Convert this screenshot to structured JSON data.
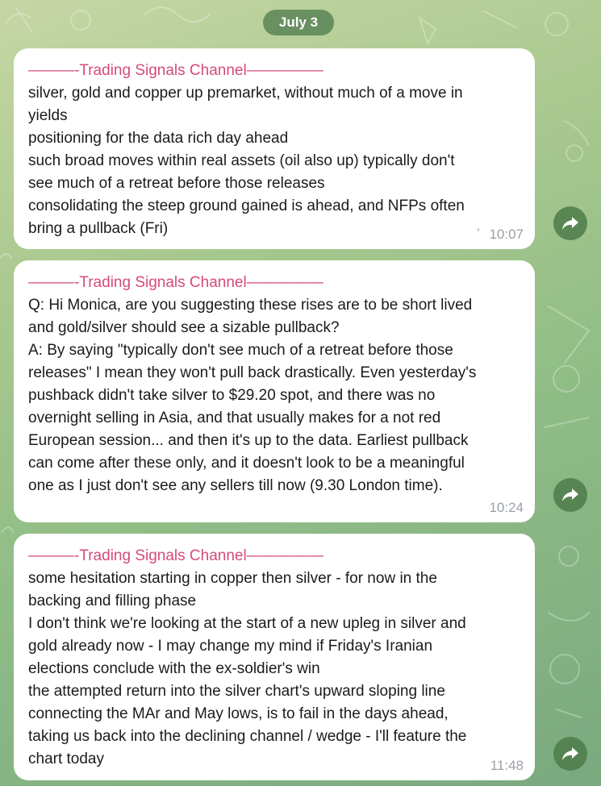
{
  "date_label": "July 3",
  "messages": [
    {
      "channel": "———-Trading Signals Channel—————",
      "lines": [
        "silver, gold and copper up premarket, without much of a move in",
        "yields",
        "positioning for the data rich day ahead",
        "such broad moves within real assets (oil also up) typically don't",
        "see much of a retreat before those releases",
        "consolidating the steep ground gained is ahead, and NFPs often",
        "bring a pullback (Fri)"
      ],
      "time": "10:07"
    },
    {
      "channel": "———-Trading Signals Channel—————",
      "lines": [
        "Q: Hi Monica, are you suggesting these rises are to be short lived",
        "and gold/silver should see a sizable pullback?",
        "A: By saying \"typically don't see much of a retreat before those",
        "releases\" I mean they won't pull back drastically. Even yesterday's",
        "pushback didn't take silver to $29.20 spot, and there was no",
        "overnight selling in Asia, and that usually makes for a not red",
        "European session... and then it's up to the data. Earliest pullback",
        "can come after these only, and it doesn't look to be a meaningful",
        "one as I just don't see any sellers till now (9.30 London time)."
      ],
      "time": "10:24"
    },
    {
      "channel": "———-Trading Signals Channel—————",
      "lines": [
        "some hesitation starting in copper then silver - for now in the",
        "backing and filling phase",
        "I don't think we're looking at the start of a new upleg in silver and",
        "gold already now - I may change my mind if Friday's Iranian",
        "elections conclude with the ex-soldier's win",
        "the attempted return into the silver chart's upward sloping line",
        "connecting the MAr and May lows, is to fail in the days ahead,",
        "taking us back into the declining channel / wedge - I'll feature the",
        "chart today"
      ],
      "time": "11:48"
    }
  ],
  "icons": {
    "share": "share-arrow-icon"
  },
  "colors": {
    "channel_accent": "#d54a7c",
    "bubble_bg": "#ffffff",
    "time_text": "#9aa0a6",
    "date_pill": "#4e7a4c"
  }
}
